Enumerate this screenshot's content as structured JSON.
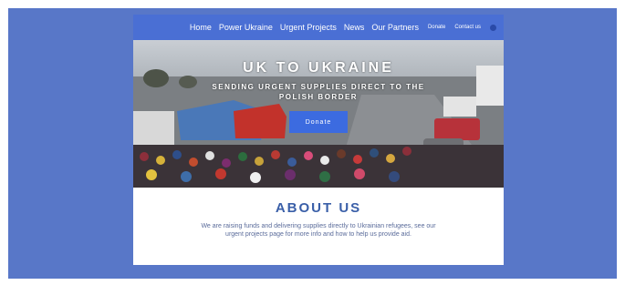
{
  "nav": {
    "items": [
      "Home",
      "Power Ukraine",
      "Urgent Projects",
      "News",
      "Our Partners"
    ],
    "small_items": [
      "Donate",
      "Contact us"
    ]
  },
  "hero": {
    "title": "UK TO UKRAINE",
    "subtitle": "SENDING URGENT SUPPLIES DIRECT TO THE POLISH BORDER",
    "button_label": "Donate"
  },
  "about": {
    "title": "ABOUT US",
    "body": "We are raising funds and delivering supplies directly to Ukrainian refugees, see our urgent projects page for more info and how to help us provide aid."
  },
  "colors": {
    "outer_background": "#5877c8",
    "nav_background": "#4a6fd4",
    "button": "#3c6be0",
    "heading": "#3a5fa8"
  }
}
